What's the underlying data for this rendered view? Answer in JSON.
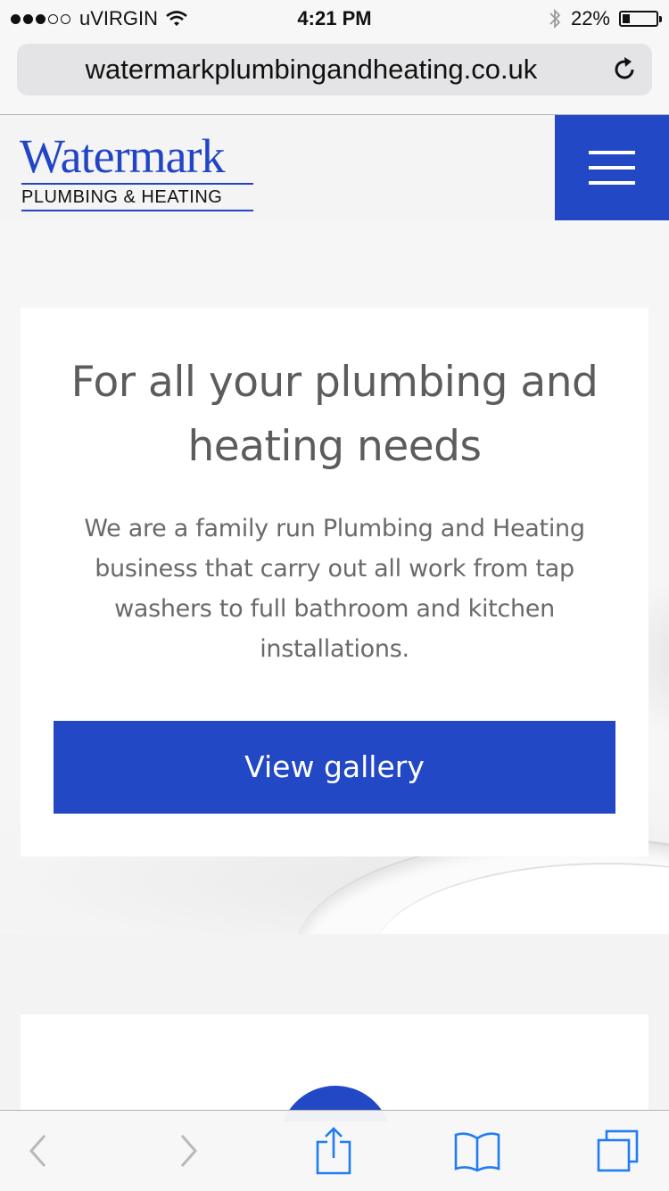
{
  "status_bar": {
    "signal_filled": 3,
    "signal_total": 5,
    "carrier": "uVIRGIN",
    "time": "4:21 PM",
    "battery": "22%",
    "battery_level": 0.22
  },
  "browser": {
    "url": "watermarkplumbingandheating.co.uk"
  },
  "site": {
    "logo_name": "Watermark",
    "logo_tagline": "PLUMBING & HEATING",
    "brand_color": "#2248c6",
    "menu_icon": "hamburger-icon"
  },
  "hero": {
    "title": "For all your plumbing and heating needs",
    "text": "We are a family run Plumbing and Heating business that carry out all work from tap washers to full bathroom and kitchen installations.",
    "button_label": "View gallery"
  },
  "toolbar": {
    "icons": [
      "back-icon",
      "forward-icon",
      "share-icon",
      "bookmarks-icon",
      "tabs-icon"
    ],
    "accent": "#1f7cf5",
    "disabled": "#b8b8bd"
  }
}
